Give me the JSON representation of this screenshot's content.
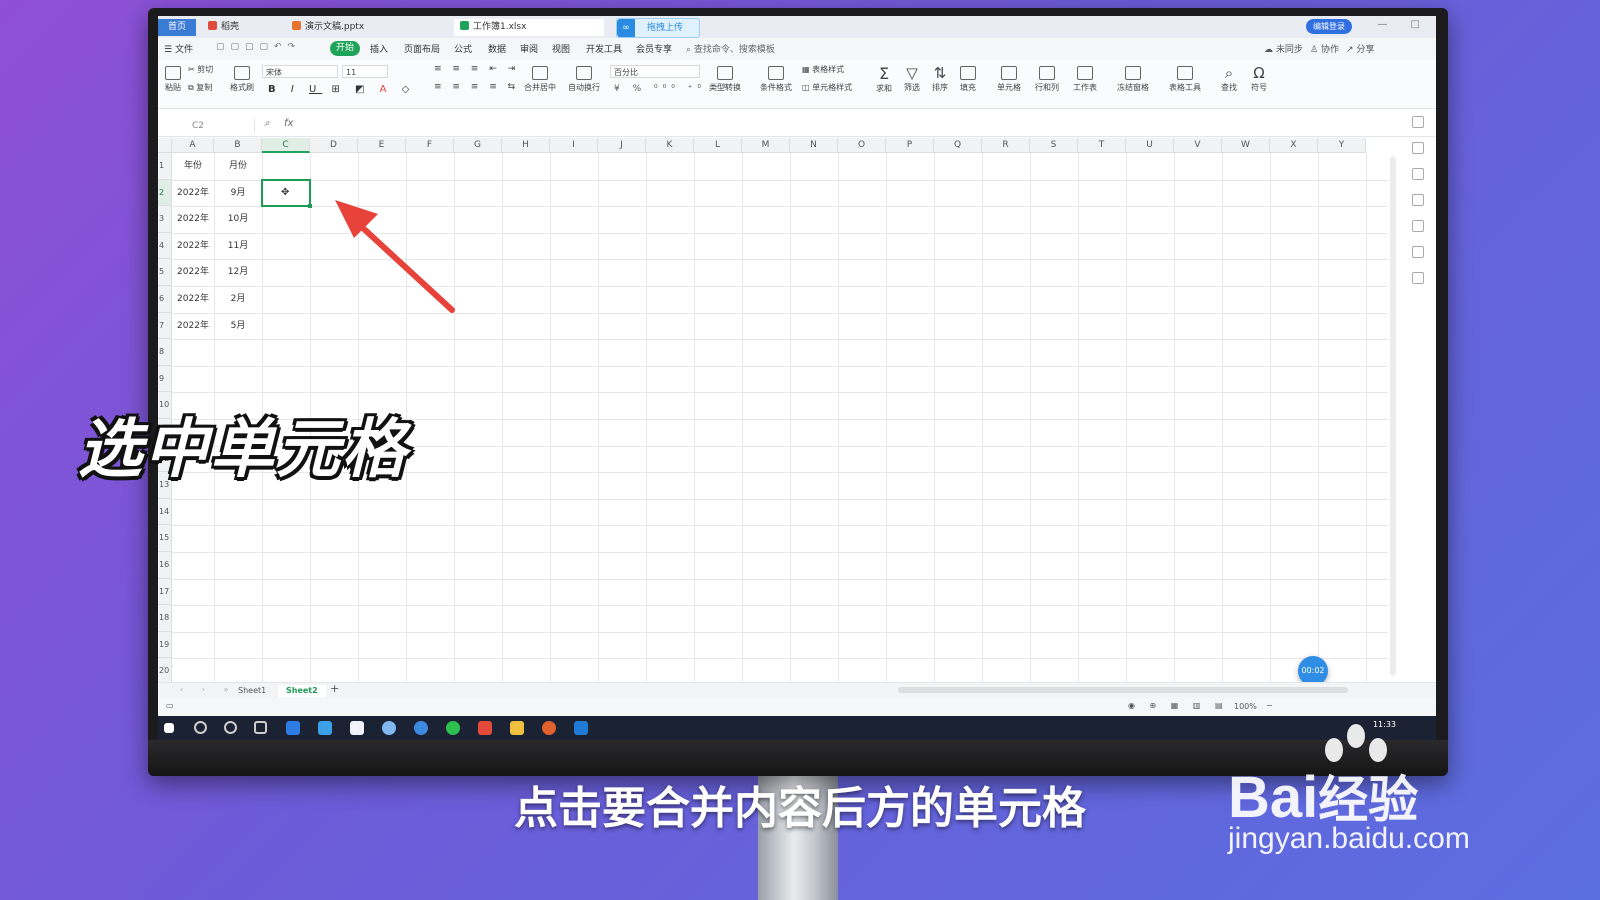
{
  "tabs": {
    "home": "首页",
    "t1": "稻壳",
    "t2": "演示文稿.pptx",
    "t3": "工作簿1.xlsx",
    "upload": "拖拽上传"
  },
  "header": {
    "login": "编辑登录"
  },
  "menu": {
    "file": "文件",
    "start": "开始",
    "insert": "插入",
    "layout": "页面布局",
    "formula": "公式",
    "data": "数据",
    "review": "审阅",
    "view": "视图",
    "dev": "开发工具",
    "member": "会员专享",
    "search": "查找命令、搜索模板",
    "sync": "未同步",
    "collab": "协作",
    "share": "分享"
  },
  "ribbon": {
    "paste": "粘贴",
    "cut": "剪切",
    "copy": "复制",
    "format_painter": "格式刷",
    "font": "宋体",
    "size": "11",
    "merge": "合并居中",
    "wrap": "自动换行",
    "num_format": "百分比",
    "type_convert": "类型转换",
    "cond_format": "条件格式",
    "table_style": "表格样式",
    "cell_style": "单元格样式",
    "sum": "求和",
    "filter": "筛选",
    "sort": "排序",
    "fill": "填充",
    "cell": "单元格",
    "rowcol": "行和列",
    "sheet": "工作表",
    "freeze": "冻结窗格",
    "table_tools": "表格工具",
    "find": "查找",
    "symbol": "符号"
  },
  "formula_bar": {
    "name_box": "C2",
    "fx": "fx"
  },
  "columns": [
    "A",
    "B",
    "C",
    "D",
    "E",
    "F",
    "G",
    "H",
    "I",
    "J",
    "K",
    "L",
    "M",
    "N",
    "O",
    "P",
    "Q",
    "R",
    "S",
    "T",
    "U",
    "V",
    "W",
    "X",
    "Y"
  ],
  "rows": [
    "1",
    "2",
    "3",
    "4",
    "5",
    "6",
    "7",
    "8",
    "9",
    "10",
    "11",
    "12",
    "13",
    "14",
    "15",
    "16",
    "17",
    "18",
    "19",
    "20"
  ],
  "cells": {
    "A1": "年份",
    "B1": "月份",
    "A2": "2022年",
    "B2": "9月",
    "A3": "2022年",
    "B3": "10月",
    "A4": "2022年",
    "B4": "11月",
    "A5": "2022年",
    "B5": "12月",
    "A6": "2022年",
    "B6": "2月",
    "A7": "2022年",
    "B7": "5月"
  },
  "sheets": [
    "Sheet1",
    "Sheet2"
  ],
  "active_sheet": "Sheet2",
  "status": {
    "zoom": "100%"
  },
  "timer": "00:02",
  "taskbar": {
    "time": "11:33"
  },
  "overlay": {
    "label": "选中单元格",
    "subtitle": "点击要合并内容后方的单元格"
  },
  "watermark": {
    "brand": "Bai",
    "brand_cn": "经验",
    "url": "jingyan.baidu.com"
  },
  "colors": {
    "accent": "#1d9a54",
    "arrow": "#e8433a",
    "blue": "#2f6fe0"
  }
}
